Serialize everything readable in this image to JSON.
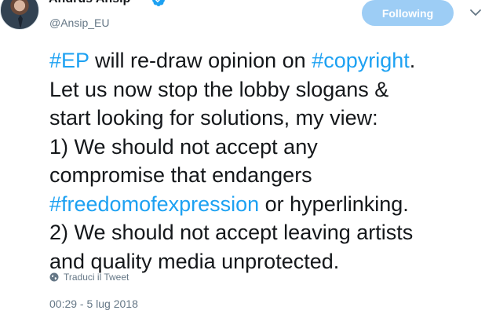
{
  "author": {
    "display_name": "Andrus Ansip",
    "handle": "@Ansip_EU",
    "verified": true
  },
  "follow_button": {
    "label": "Following",
    "color": "#9dcdf5"
  },
  "tweet": {
    "segments": {
      "s1": "#EP",
      "s2": " will re-draw opinion on ",
      "s3": "#copyright",
      "s4": ".",
      "s5": "Let us now stop the lobby slogans &",
      "s6": "start looking for solutions, my view:",
      "s7": "1) We should not accept any",
      "s8": "compromise that endangers",
      "s9": "#freedomofexpression",
      "s10": " or hyperlinking.",
      "s11": "2) We should not accept leaving artists",
      "s12": "and quality media unprotected."
    },
    "hashtag_color": "#1da1f2"
  },
  "translate": {
    "label": "Traduci il Tweet",
    "icon": "globe-icon"
  },
  "timestamp": "00:29 - 5 lug 2018",
  "icons": {
    "verified": "verified-badge-icon",
    "caret": "chevron-down-icon"
  }
}
